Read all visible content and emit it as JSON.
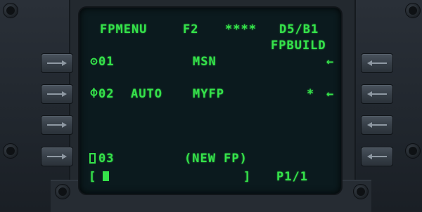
{
  "header": {
    "menu": "FPMENU",
    "page_key": "F2",
    "stars": "****",
    "mode": "D5/B1",
    "sub_title": "FPBUILD"
  },
  "rows": [
    {
      "index": "01",
      "mode": "",
      "name": "MSN",
      "mark": "←"
    },
    {
      "index": "02",
      "mode": "AUTO",
      "name": "MYFP",
      "star": "*",
      "mark": "←"
    },
    {
      "index": "03",
      "mode": "",
      "name": "(NEW FP)",
      "mark": ""
    }
  ],
  "scratchpad": {
    "open_bracket": "[",
    "close_bracket": "]",
    "page_indicator": "P1/1"
  },
  "colors": {
    "text": "#35e24a",
    "screen": "#0b1a1e",
    "bezel": "#20262d",
    "button": "#3a424b"
  },
  "icons": {
    "lsk_left": "arrow-right-icon",
    "lsk_right": "arrow-left-icon",
    "row1_symbol": "circle-dot-icon",
    "row2_symbol": "circle-crosshair-icon",
    "row3_symbol": "rectangle-icon"
  }
}
